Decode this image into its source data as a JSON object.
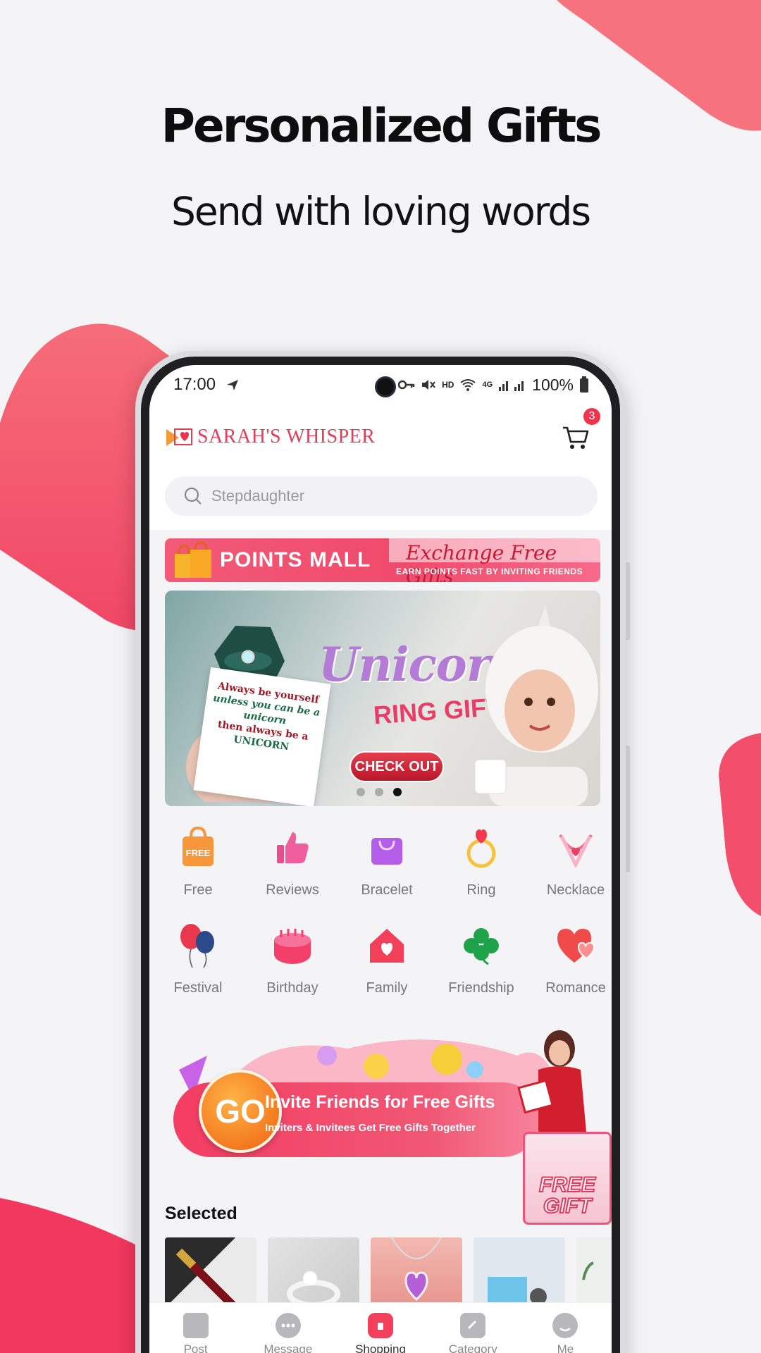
{
  "hero": {
    "title": "Personalized Gifts",
    "subtitle": "Send with loving words"
  },
  "status_bar": {
    "time": "17:00",
    "network_label": "HD",
    "signal_label": "4G",
    "battery": "100%"
  },
  "app": {
    "brand": "SARAH'S WHISPER",
    "cart_count": "3"
  },
  "search": {
    "placeholder": "Stepdaughter"
  },
  "points_banner": {
    "title": "POINTS MALL",
    "script": "Exchange Free Gifts",
    "subtitle": "EARN POINTS FAST BY INVITING FRIENDS"
  },
  "carousel": {
    "title": "Unicorn",
    "subtitle": "RING GIFT",
    "card_lines": [
      "Always be yourself",
      "unless you can be a unicorn",
      "then always be a",
      "UNICORN"
    ],
    "button": "CHECK OUT",
    "active_index": 2,
    "count": 3
  },
  "categories": [
    {
      "label": "Free",
      "icon": "free-bag-icon"
    },
    {
      "label": "Reviews",
      "icon": "thumbs-up-icon"
    },
    {
      "label": "Bracelet",
      "icon": "bag-icon"
    },
    {
      "label": "Ring",
      "icon": "ring-icon"
    },
    {
      "label": "Necklace",
      "icon": "necklace-icon"
    },
    {
      "label": "Festival",
      "icon": "balloons-icon"
    },
    {
      "label": "Birthday",
      "icon": "cake-icon"
    },
    {
      "label": "Family",
      "icon": "house-icon"
    },
    {
      "label": "Friendship",
      "icon": "clover-icon"
    },
    {
      "label": "Romance",
      "icon": "hearts-icon"
    }
  ],
  "free_badge": "FREE",
  "invite": {
    "go": "GO",
    "title": "Invite Friends for Free Gifts",
    "subtitle": "Inviters & Invitees Get Free Gifts Together",
    "badge_line1": "FREE",
    "badge_line2": "GIFT"
  },
  "selected": {
    "title": "Selected"
  },
  "tabs": [
    {
      "label": "Post",
      "icon": "diamond-icon",
      "active": false
    },
    {
      "label": "Message",
      "icon": "chat-icon",
      "active": false
    },
    {
      "label": "Shopping",
      "icon": "shop-icon",
      "active": true
    },
    {
      "label": "Category",
      "icon": "tag-icon",
      "active": false
    },
    {
      "label": "Me",
      "icon": "user-icon",
      "active": false
    }
  ],
  "colors": {
    "accent": "#f23f5a",
    "blob": "#f4506c",
    "background": "#f4f4f6"
  }
}
